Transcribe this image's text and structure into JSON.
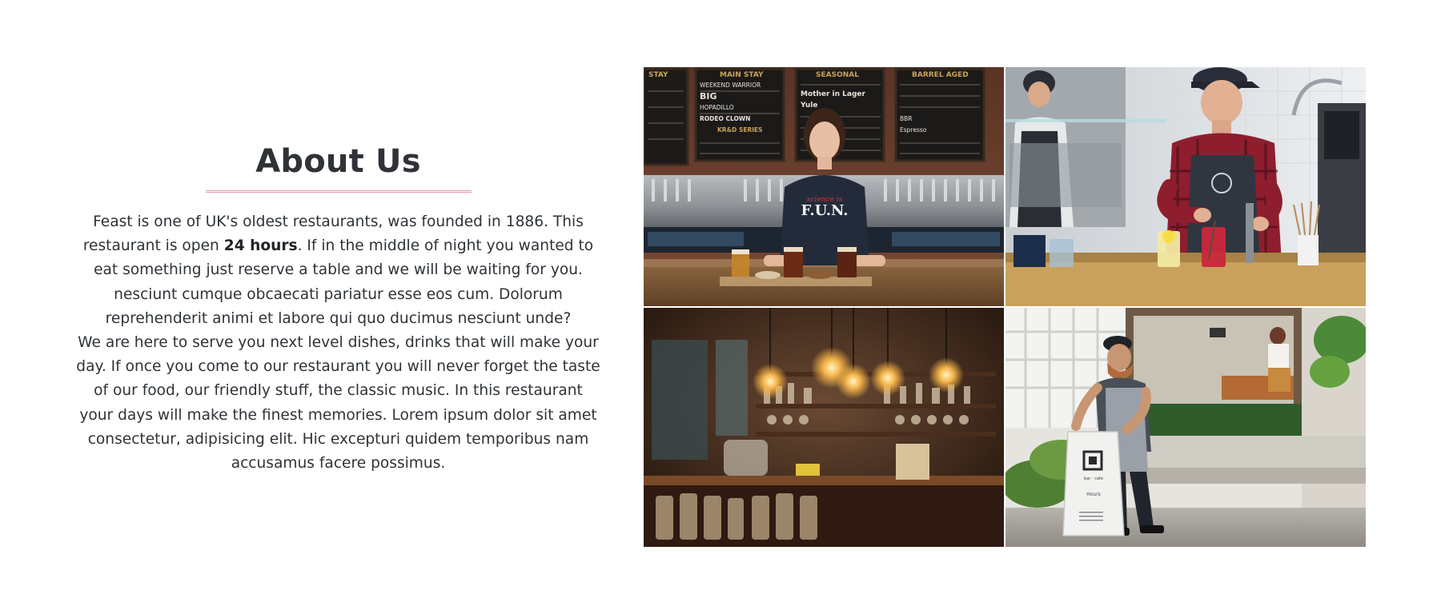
{
  "about": {
    "title": "About Us",
    "paragraph1_pre": "Feast is one of UK's oldest restaurants, was founded in 1886. This restaurant is open ",
    "paragraph1_bold": "24 hours",
    "paragraph1_post": ". If in the middle of night you wanted to eat something just reserve a table and we will be waiting for you. nesciunt cumque obcaecati pariatur esse eos cum. Dolorum reprehenderit animi et labore qui quo ducimus nesciunt unde?",
    "paragraph2": "We are here to serve you next level dishes, drinks that will make your day. If once you come to our restaurant you will never forget the taste of our food, our friendly stuff, the classic music. In this restaurant your days will make the finest memories. Lorem ipsum dolor sit amet consectetur, adipisicing elit. Hic excepturi quidem temporibus nam accusamus facere possimus."
  },
  "photos": {
    "bar": {
      "board_headers": [
        "STAY",
        "MAIN STAY",
        "SEASONAL",
        "BARREL AGED"
      ],
      "board_col2": [
        "WEEKEND WARRIOR",
        "BIG",
        "HOPADILLO",
        "RODEO CLOWN",
        "KR&D SERIES"
      ],
      "board_col3": [
        "Mother in Lager",
        "Yule"
      ],
      "board_col4": [
        "BBR",
        "Espresso"
      ],
      "shirt_script": "science is",
      "shirt_text": "F.U.N."
    },
    "sign": {
      "line1": "bar · cafe",
      "line2": "Hours"
    },
    "colors": {
      "brand_accent": "#e59aa5",
      "text_dark": "#2e3338"
    }
  }
}
